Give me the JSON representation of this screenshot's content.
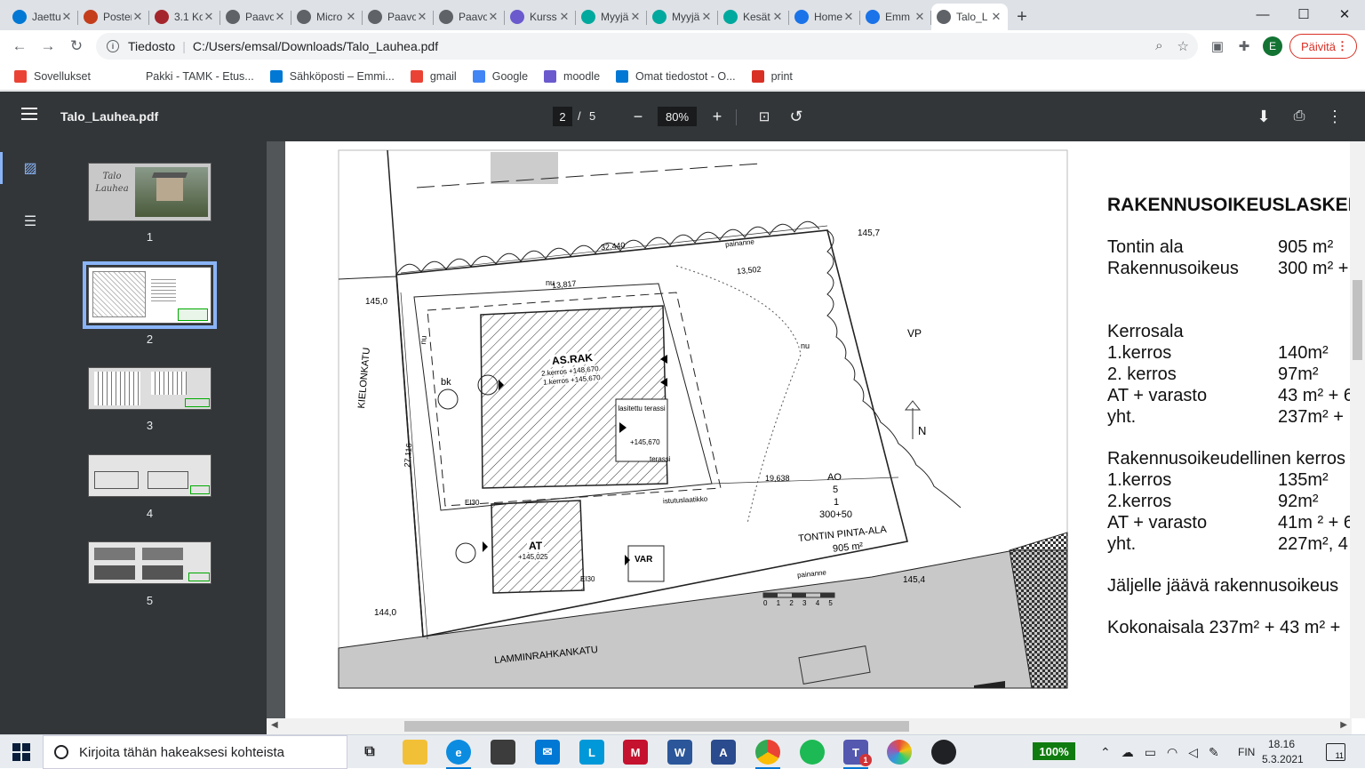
{
  "browser": {
    "tabs": [
      {
        "title": "Jaettu",
        "color": "#0078d4"
      },
      {
        "title": "Poster",
        "color": "#c43e1c"
      },
      {
        "title": "3.1 Ko",
        "color": "#a4262c"
      },
      {
        "title": "Paavo",
        "color": "#5f6368"
      },
      {
        "title": "Micro",
        "color": "#5f6368"
      },
      {
        "title": "Paavo",
        "color": "#5f6368"
      },
      {
        "title": "Paavo",
        "color": "#5f6368"
      },
      {
        "title": "Kurss",
        "color": "#6a5acd"
      },
      {
        "title": "Myyjä",
        "color": "#00a99d"
      },
      {
        "title": "Myyjä",
        "color": "#00a99d"
      },
      {
        "title": "Kesät",
        "color": "#00a99d"
      },
      {
        "title": "Home",
        "color": "#1a73e8"
      },
      {
        "title": "Emm",
        "color": "#1a73e8"
      },
      {
        "title": "Talo_L",
        "color": "#5f6368"
      }
    ],
    "new_tab": "+",
    "window_controls": {
      "minimize": "—",
      "maximize": "☐",
      "close": "✕"
    },
    "address": {
      "scheme_label": "Tiedosto",
      "path": "C:/Users/emsal/Downloads/Talo_Lauhea.pdf"
    },
    "profile_initial": "E",
    "update_label": "Päivitä",
    "bookmarks": [
      {
        "label": "Sovellukset",
        "color": "#ea4335"
      },
      {
        "label": "Pakki - TAMK - Etus...",
        "color": "#ffffff"
      },
      {
        "label": "Sähköposti – Emmi...",
        "color": "#0078d4"
      },
      {
        "label": "gmail",
        "color": "#ea4335"
      },
      {
        "label": "Google",
        "color": "#4285f4"
      },
      {
        "label": "moodle",
        "color": "#6a5acd"
      },
      {
        "label": "Omat tiedostot - O...",
        "color": "#0078d4"
      },
      {
        "label": "print",
        "color": "#d93025"
      }
    ]
  },
  "pdf": {
    "filename": "Talo_Lauhea.pdf",
    "current_page": "2",
    "page_separator": "/",
    "total_pages": "5",
    "zoom": "80%",
    "thumbnails": [
      "1",
      "2",
      "3",
      "4",
      "5"
    ],
    "thumb1_title": "Talo Lauhea"
  },
  "plan": {
    "street_left": "KIELONKATU",
    "street_bottom": "LAMMINRAHKANKATU",
    "vp": "VP",
    "north": "N",
    "elev_tl": "145,0",
    "elev_tr": "145,7",
    "elev_bl": "144,0",
    "elev_br": "145,4",
    "main_bldg": "AS.RAK",
    "main_bldg_sub1": "2.kerros +148,670",
    "main_bldg_sub2": "1.kerros +145,670",
    "garage": "AT",
    "garage_elev": "+145,025",
    "storage": "VAR",
    "terrace1": "lasitettu terassi",
    "terrace2": "terassi",
    "terrace_elev": "+145,670",
    "bk": "bk",
    "lot_label": "AO",
    "lot_n1": "5",
    "lot_n2": "1",
    "lot_n3": "300+50",
    "lot_area_label": "TONTIN PINTA-ALA",
    "lot_area_value": "905 m²",
    "dim_top": "32,440",
    "dim_top2": "13,817",
    "dim_top3": "13,502",
    "dim_left": "27,116",
    "dim_mid": "19,638",
    "scale": "0 1 2 3 4 5",
    "nu": "nu",
    "painanne": "painanne",
    "istutus": "istutuslaatikko",
    "ei30": "EI30"
  },
  "calc": {
    "title": "RAKENNUSOIKEUSLASKEL",
    "rows_a": [
      {
        "k": "Tontin ala",
        "v": "905 m²"
      },
      {
        "k": "Rakennusoikeus",
        "v": "300 m² +"
      }
    ],
    "kerrosala_title": "Kerrosala",
    "rows_b": [
      {
        "k": "1.kerros",
        "v": "140m²"
      },
      {
        "k": "2. kerros",
        "v": "97m²"
      },
      {
        "k": "AT + varasto",
        "v": "43 m² + 6"
      },
      {
        "k": "yht.",
        "v": "237m² +"
      }
    ],
    "rak_title": "Rakennusoikeudellinen kerros",
    "rows_c": [
      {
        "k": "1.kerros",
        "v": "135m²"
      },
      {
        "k": "2.kerros",
        "v": "92m²"
      },
      {
        "k": "AT + varasto",
        "v": "41m ² + 6"
      },
      {
        "k": "yht.",
        "v": "227m², 4"
      }
    ],
    "remaining": "Jäljelle jäävä rakennusoikeus",
    "total": "Kokonaisala 237m² + 43 m² +"
  },
  "taskbar": {
    "search_placeholder": "Kirjoita tähän hakeaksesi kohteista",
    "battery": "100%",
    "language": "FIN",
    "time": "18.16",
    "date": "5.3.2021",
    "notifications": "11",
    "teams_badge": "1"
  }
}
